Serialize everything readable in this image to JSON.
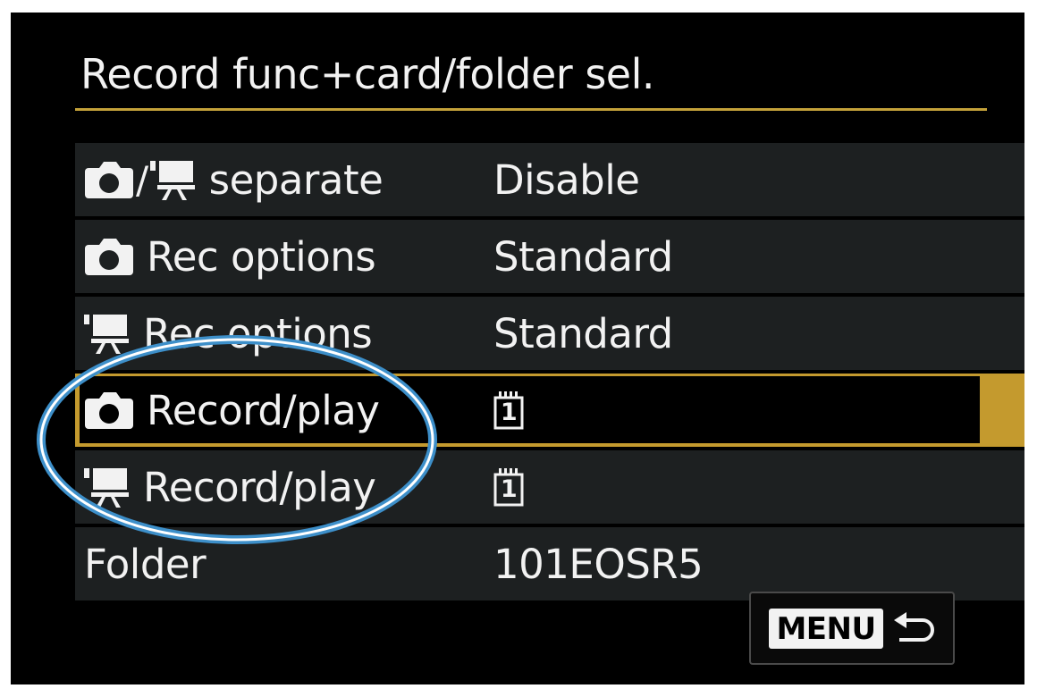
{
  "screen": {
    "title": "Record func+card/folder sel."
  },
  "menu": {
    "rows": [
      {
        "label": "separate",
        "value": "Disable",
        "icons": [
          "camera-icon",
          "movie-icon"
        ]
      },
      {
        "label": "Rec options",
        "value": "Standard",
        "icons": [
          "camera-icon"
        ]
      },
      {
        "label": "Rec options",
        "value": "Standard",
        "icons": [
          "movie-icon"
        ]
      },
      {
        "label": "Record/play",
        "value": "1",
        "icons": [
          "camera-icon",
          "card-slot-icon"
        ],
        "selected": true
      },
      {
        "label": "Record/play",
        "value": "1",
        "icons": [
          "movie-icon",
          "card-slot-icon"
        ]
      },
      {
        "label": "Folder",
        "value": "101EOSR5"
      }
    ]
  },
  "footer": {
    "menu_label": "MENU",
    "back_icon": "return-arrow-icon"
  },
  "colors": {
    "background": "#000000",
    "row": "#1d2021",
    "selection": "#c49a2e",
    "title_rule": "#c4a23a",
    "callout": "#3d8fc9"
  }
}
